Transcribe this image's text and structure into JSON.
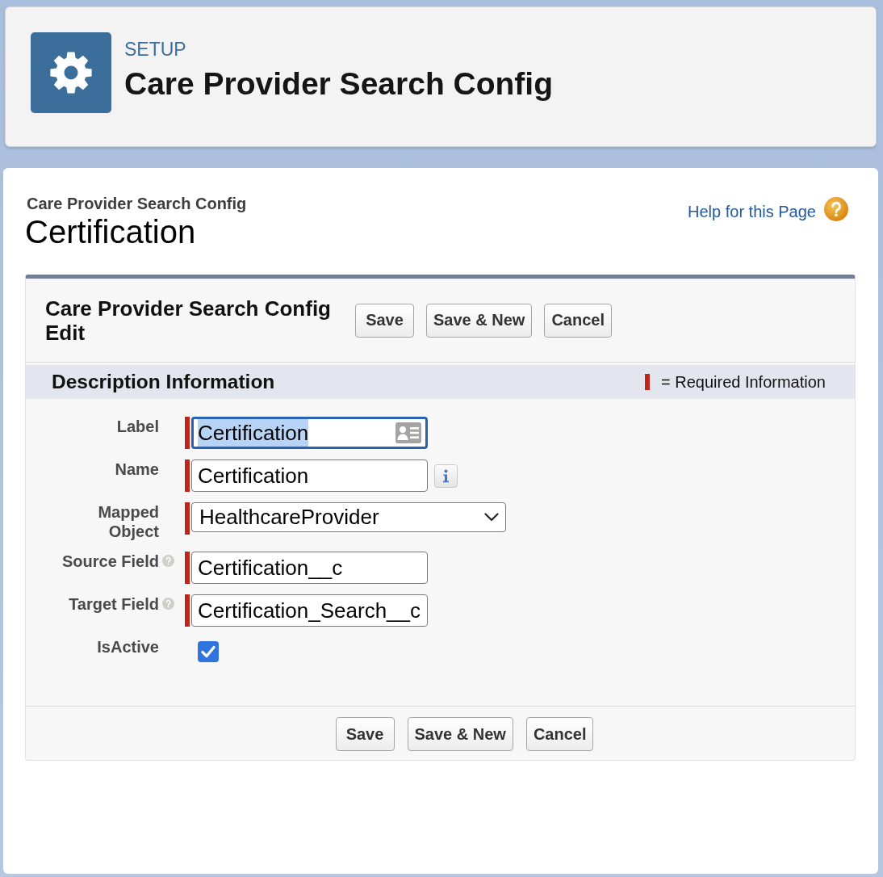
{
  "header": {
    "eyebrow": "SETUP",
    "title": "Care Provider Search Config"
  },
  "page": {
    "breadcrumb": "Care Provider Search Config",
    "title": "Certification",
    "help_link": "Help for this Page"
  },
  "form": {
    "title": "Care Provider Search Config Edit",
    "top_buttons": [
      "Save",
      "Save & New",
      "Cancel"
    ],
    "section": {
      "title": "Description Information",
      "required_legend": "= Required Information"
    },
    "fields": [
      {
        "label": "Label",
        "kind": "cardtext",
        "value": "Certification",
        "required": true,
        "focused": true,
        "help": false
      },
      {
        "label": "Name",
        "kind": "infotext",
        "value": "Certification",
        "required": true,
        "focused": false,
        "help": false
      },
      {
        "label": "Mapped Object",
        "kind": "select",
        "value": "HealthcareProvider",
        "required": true,
        "focused": false,
        "help": false
      },
      {
        "label": "Source Field",
        "kind": "text",
        "value": "Certification__c",
        "required": true,
        "focused": false,
        "help": true
      },
      {
        "label": "Target Field",
        "kind": "text",
        "value": "Certification_Search__c",
        "required": true,
        "focused": false,
        "help": true
      },
      {
        "label": "IsActive",
        "kind": "checkbox",
        "checked": true,
        "required": false,
        "focused": false,
        "help": false
      }
    ],
    "bottom_buttons": [
      "Save",
      "Save & New",
      "Cancel"
    ]
  }
}
